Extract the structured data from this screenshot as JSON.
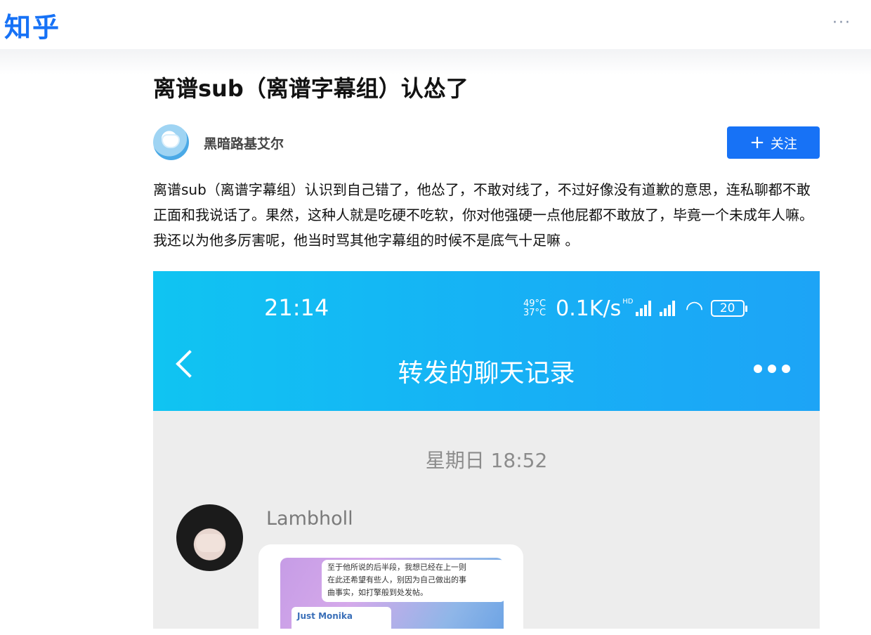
{
  "header": {
    "logo": "知乎",
    "more": "···"
  },
  "article": {
    "title": "离谱sub（离谱字幕组）认怂了",
    "author_name": "黑暗路基艾尔",
    "follow_label": "关注",
    "body": "离谱sub（离谱字幕组）认识到自己错了，他怂了，不敢对线了，不过好像没有道歉的意思，连私聊都不敢正面和我说话了。果然，这种人就是吃硬不吃软，你对他强硬一点他屁都不敢放了，毕竟一个未成年人嘛。我还以为他多厉害呢，他当时骂其他字幕组的时候不是底气十足嘛 。"
  },
  "screenshot": {
    "status_time": "21:14",
    "temp_high": "49°C",
    "temp_low": "37°C",
    "speed": "0.1K/s",
    "hd": "HD",
    "battery": "20",
    "nav_title": "转发的聊天记录",
    "date_label": "星期日 18:52",
    "sender": "Lambholl",
    "inner_text_lines": [
      "至于他所说的后半段，我想已经在上一则",
      "在此还希望有些人，别因为自己做出的事",
      "曲事实，如打擎般到处发帖。"
    ],
    "inner_name": "Just Monika"
  }
}
